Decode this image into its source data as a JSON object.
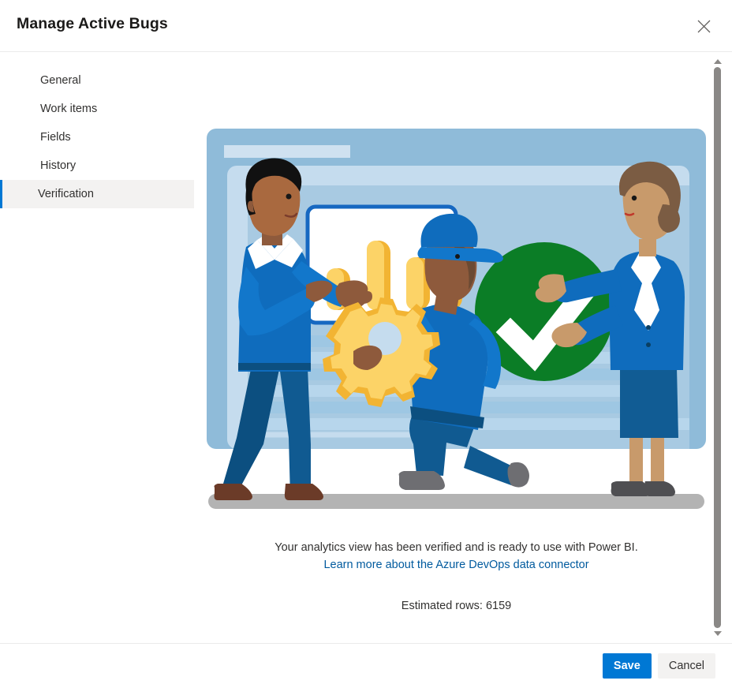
{
  "dialog": {
    "title": "Manage Active Bugs",
    "close_icon": "close-icon"
  },
  "sidebar": {
    "items": [
      {
        "label": "General",
        "selected": false
      },
      {
        "label": "Work items",
        "selected": false
      },
      {
        "label": "Fields",
        "selected": false
      },
      {
        "label": "History",
        "selected": false
      },
      {
        "label": "Verification",
        "selected": true
      }
    ]
  },
  "main": {
    "illustration": {
      "name": "verification-success-illustration",
      "description": "Three people with a bar chart, a gear and a large green checkmark",
      "colors": {
        "panel_outer": "#8fbbd9",
        "panel_mid": "#c5dcee",
        "panel_inner": "#a8cae2",
        "bar_light": "#fcd367",
        "bar_dark": "#f2b433",
        "check_green": "#0b7d26",
        "shirt_blue": "#0f6cbd",
        "pants_blue": "#105a91",
        "ground_gray": "#b3b3b3",
        "card_border": "#1668c1"
      }
    },
    "verified_message": "Your analytics view has been verified and is ready to use with Power BI.",
    "learn_more_link": "Learn more about the Azure DevOps data connector",
    "estimated_rows": "Estimated rows: 6159"
  },
  "scrollbar": {
    "up_icon": "chevron-up-icon",
    "down_icon": "chevron-down-icon"
  },
  "footer": {
    "save_label": "Save",
    "cancel_label": "Cancel"
  },
  "colors": {
    "accent": "#0078d4",
    "link": "#005a9e",
    "selected_bg": "#f3f2f1"
  }
}
